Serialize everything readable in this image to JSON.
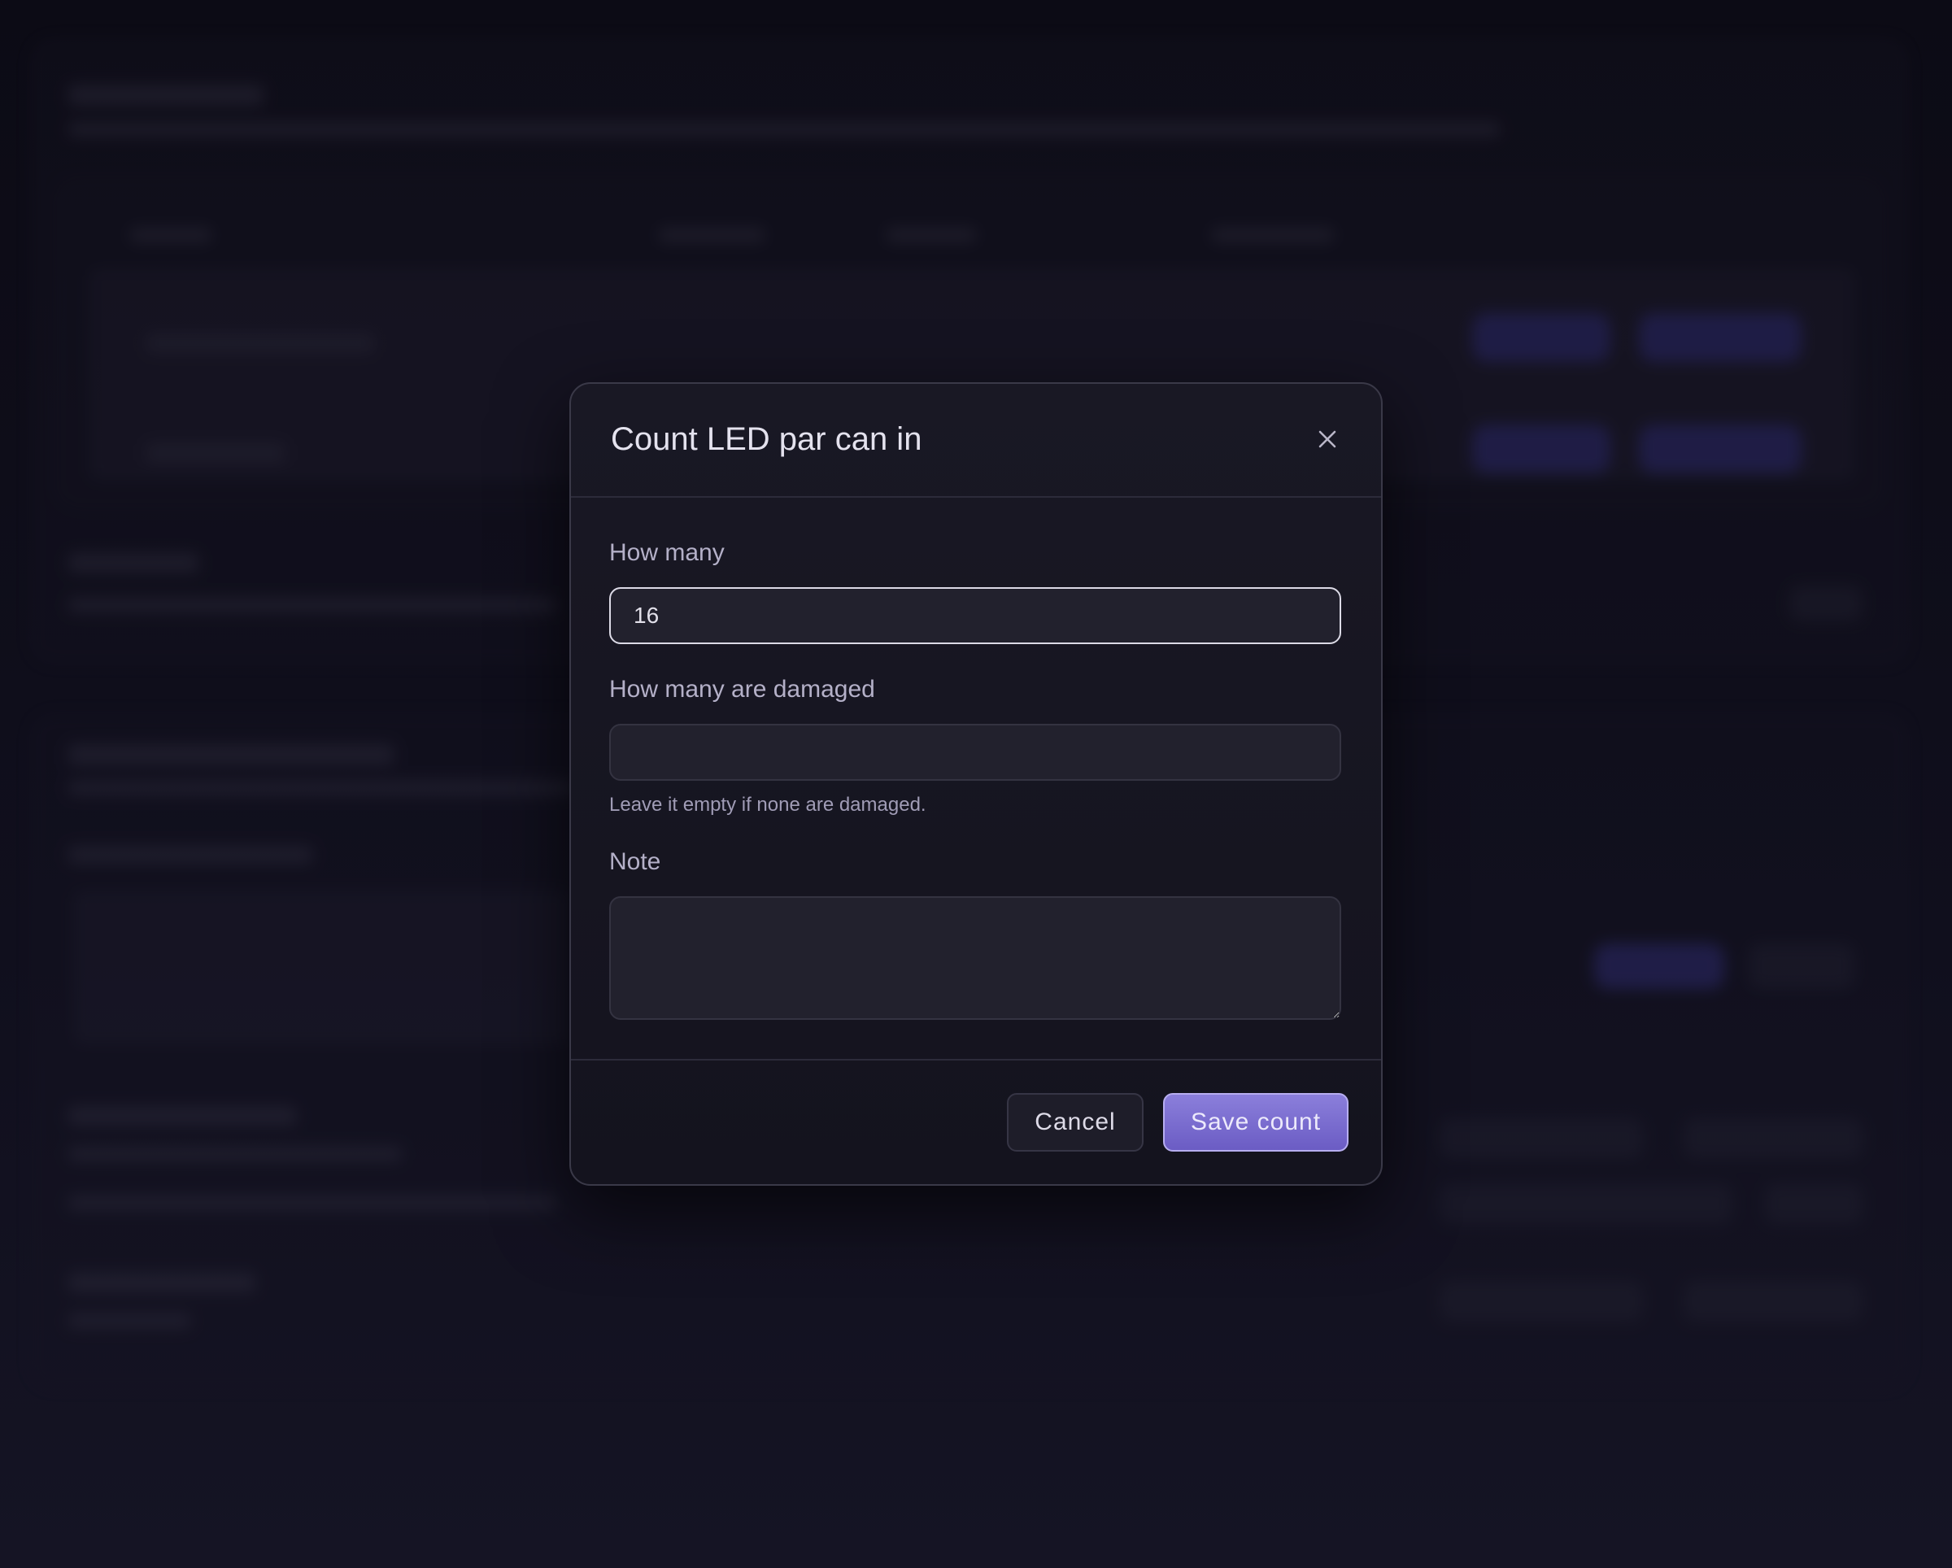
{
  "dialog": {
    "title": "Count LED par can in",
    "close_icon": "close-icon",
    "fields": {
      "how_many": {
        "label": "How many",
        "value": "16"
      },
      "damaged": {
        "label": "How many are damaged",
        "value": "",
        "hint": "Leave it empty if none are damaged."
      },
      "note": {
        "label": "Note",
        "value": ""
      }
    },
    "buttons": {
      "cancel": "Cancel",
      "save": "Save count"
    }
  },
  "colors": {
    "accent": "#7a6dd3",
    "backdrop": "#0d0c17",
    "dialog_bg": "#16151f"
  }
}
